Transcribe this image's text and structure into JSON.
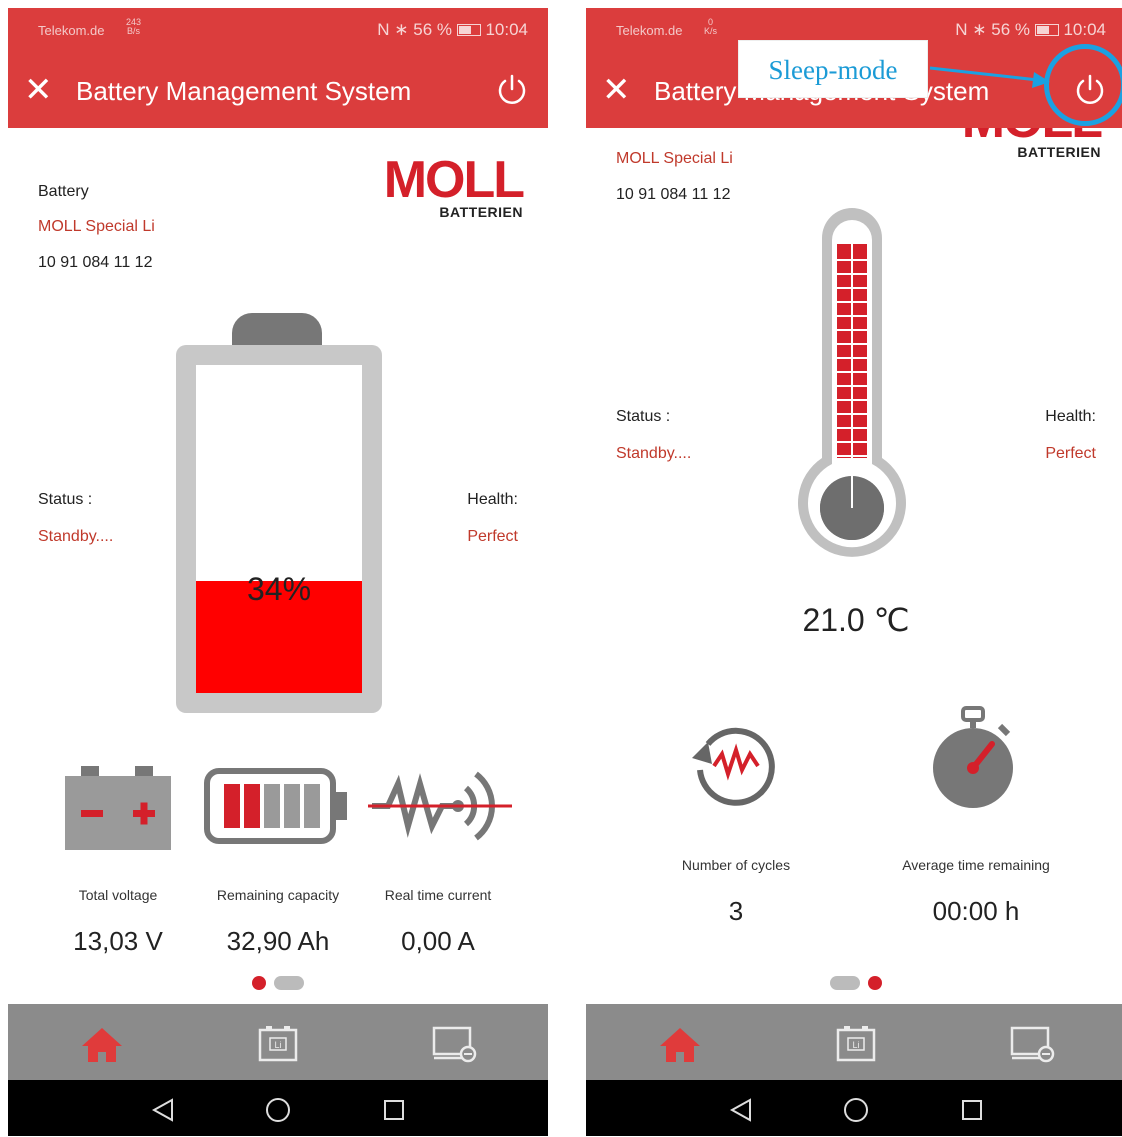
{
  "status_bar": {
    "left_carrier": "Telekom.de",
    "left_netspeed_value": "243",
    "left_netspeed_unit": "B/s",
    "right_carrier": "Telekom.de",
    "right_netspeed_value": "0",
    "right_netspeed_unit": "K/s",
    "battery_percent": "56 %",
    "time": "10:04"
  },
  "app_bar": {
    "title": "Battery Management System",
    "close_icon": "close-icon",
    "power_icon": "power-icon"
  },
  "battery_info": {
    "label": "Battery",
    "model": "MOLL Special Li",
    "serial": "10 91 084 11 12"
  },
  "logo": {
    "word": "MOLL",
    "subtitle": "BATTERIEN"
  },
  "status": {
    "status_label": "Status :",
    "status_value": "Standby....",
    "health_label": "Health:",
    "health_value": "Perfect"
  },
  "battery_gauge": {
    "percent_text": "34%",
    "fill_fraction": 0.34
  },
  "metrics_page1": [
    {
      "label": "Total voltage",
      "value": "13,03 V",
      "icon": "car-battery-icon"
    },
    {
      "label": "Remaining capacity",
      "value": "32,90 Ah",
      "icon": "battery-level-icon"
    },
    {
      "label": "Real time current",
      "value": "0,00 A",
      "icon": "current-wave-icon"
    }
  ],
  "temperature": {
    "value": "21.0 ℃"
  },
  "metrics_page2": [
    {
      "label": "Number of cycles",
      "value": "3",
      "icon": "cycle-icon"
    },
    {
      "label": "Average time remaining",
      "value": "00:00 h",
      "icon": "stopwatch-icon"
    }
  ],
  "tabs": [
    {
      "name": "home",
      "icon": "home-icon",
      "active": true
    },
    {
      "name": "battery",
      "icon": "battery-li-icon",
      "active": false
    },
    {
      "name": "device",
      "icon": "device-settings-icon",
      "active": false
    }
  ],
  "nav_bar": {
    "icons": [
      "back-icon",
      "home-circle-icon",
      "recents-icon"
    ]
  },
  "annotation": {
    "sleep_mode_text": "Sleep-mode"
  },
  "colors": {
    "brand_red": "#db3d3d",
    "accent_red": "#d4202a",
    "tab_grey": "#8b8b8b",
    "annotation_blue": "#1ba1e2"
  }
}
